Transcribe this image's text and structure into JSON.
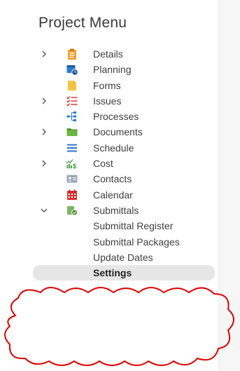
{
  "title": "Project Menu",
  "menu": {
    "items": [
      {
        "label": "Details",
        "expandable": true,
        "icon": "clipboard-icon"
      },
      {
        "label": "Planning",
        "expandable": false,
        "icon": "calendar-clock-icon"
      },
      {
        "label": "Forms",
        "expandable": false,
        "icon": "form-icon"
      },
      {
        "label": "Issues",
        "expandable": true,
        "icon": "checklist-icon"
      },
      {
        "label": "Processes",
        "expandable": false,
        "icon": "process-tree-icon"
      },
      {
        "label": "Documents",
        "expandable": true,
        "icon": "folder-icon"
      },
      {
        "label": "Schedule",
        "expandable": false,
        "icon": "schedule-lines-icon"
      },
      {
        "label": "Cost",
        "expandable": true,
        "icon": "cost-chart-icon"
      },
      {
        "label": "Contacts",
        "expandable": false,
        "icon": "contact-card-icon"
      },
      {
        "label": "Calendar",
        "expandable": false,
        "icon": "calendar-icon"
      },
      {
        "label": "Submittals",
        "expandable": true,
        "expanded": true,
        "icon": "submittals-icon"
      }
    ],
    "submittal_children": [
      {
        "label": "Submittal Register"
      },
      {
        "label": "Submittal Packages"
      },
      {
        "label": "Update Dates"
      },
      {
        "label": "Settings",
        "selected": true
      }
    ]
  },
  "colors": {
    "cloud_annotation": "#e00000",
    "selected_background": "#e6e6e6",
    "chevron": "#555555"
  }
}
